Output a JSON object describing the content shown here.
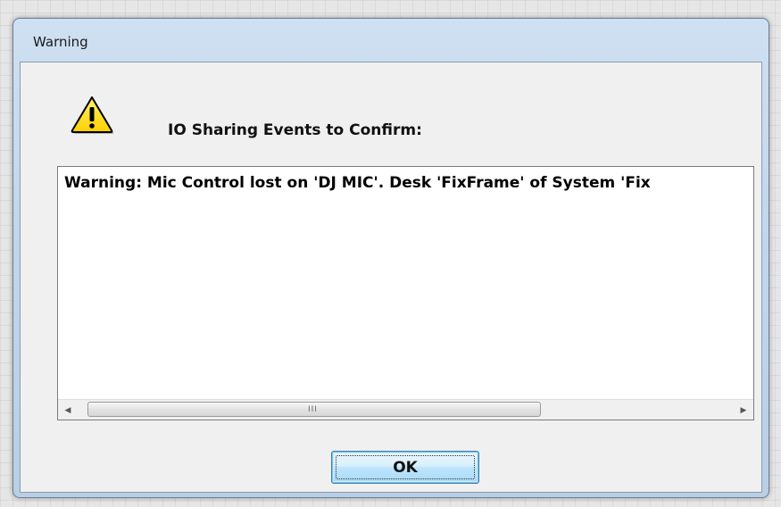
{
  "window": {
    "title": "Warning"
  },
  "dialog": {
    "icon": "warning-triangle-icon",
    "heading": "IO Sharing Events to Confirm:",
    "messages": [
      "Warning: Mic Control lost on 'DJ MIC'. Desk 'FixFrame' of System 'Fix"
    ],
    "ok_label": "OK"
  },
  "scrollbar": {
    "left_arrow": "◀",
    "right_arrow": "▶",
    "grip": "III"
  },
  "colors": {
    "warning_yellow": "#ffd800",
    "button_border": "#3c7fb1"
  }
}
